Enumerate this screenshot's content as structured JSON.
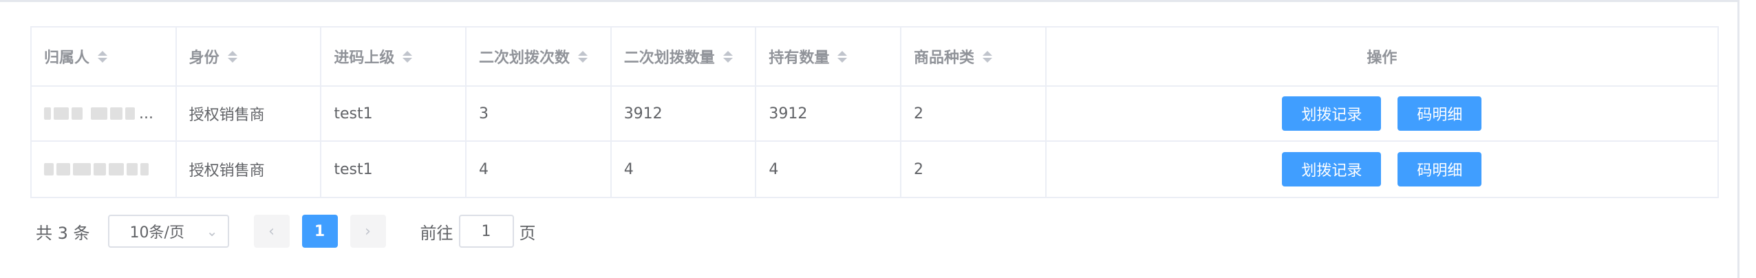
{
  "table": {
    "columns": [
      "归属人",
      "身份",
      "进码上级",
      "二次划拨次数",
      "二次划拨数量",
      "持有数量",
      "商品种类",
      "操作"
    ],
    "rows": [
      {
        "owner_suffix": "...",
        "identity": "授权销售商",
        "superior": "test1",
        "count": "3",
        "quantity": "3912",
        "holding": "3912",
        "kinds": "2"
      },
      {
        "owner_suffix": "",
        "identity": "授权销售商",
        "superior": "test1",
        "count": "4",
        "quantity": "4",
        "holding": "4",
        "kinds": "2"
      }
    ],
    "actions": {
      "transfer_records": "划拨记录",
      "code_detail": "码明细"
    }
  },
  "pagination": {
    "total": "共 3 条",
    "page_size": "10条/页",
    "prev_icon": "chevron-left-icon",
    "next_icon": "chevron-right-icon",
    "current_page": "1",
    "goto_label": "前往",
    "goto_value": "1",
    "page_suffix": "页"
  },
  "colors": {
    "primary": "#409eff",
    "border": "#ebeef5",
    "header_text": "#909399",
    "text": "#606266"
  }
}
